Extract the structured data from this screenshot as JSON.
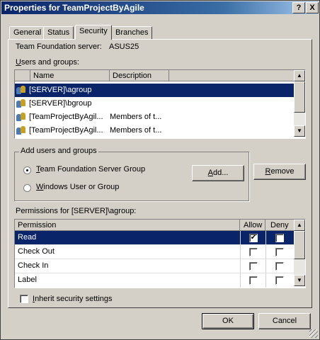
{
  "window": {
    "title": "Properties for TeamProjectByAgile",
    "help_btn": "?",
    "close_btn": "X"
  },
  "tabs": [
    {
      "label": "General"
    },
    {
      "label": "Status"
    },
    {
      "label": "Security"
    },
    {
      "label": "Branches"
    }
  ],
  "server": {
    "label": "Team Foundation server:",
    "value": "ASUS25"
  },
  "users": {
    "label": "Users and groups:",
    "columns": [
      "Name",
      "Description"
    ],
    "rows": [
      {
        "name": "[SERVER]\\agroup",
        "description": ""
      },
      {
        "name": "[SERVER]\\bgroup",
        "description": ""
      },
      {
        "name": "[TeamProjectByAgil...",
        "description": "Members of t..."
      },
      {
        "name": "[TeamProjectByAgil...",
        "description": "Members of t..."
      }
    ]
  },
  "add_group": {
    "legend": "Add users and groups",
    "option1": "Team Foundation Server Group",
    "option2": "Windows User or Group",
    "add_button": "Add...",
    "remove_button": "Remove"
  },
  "permissions": {
    "label": "Permissions for [SERVER]\\agroup:",
    "columns": [
      "Permission",
      "Allow",
      "Deny"
    ],
    "rows": [
      {
        "name": "Read",
        "allow": true,
        "deny": false
      },
      {
        "name": "Check Out",
        "allow": false,
        "deny": false
      },
      {
        "name": "Check In",
        "allow": false,
        "deny": false
      },
      {
        "name": "Label",
        "allow": false,
        "deny": false
      }
    ]
  },
  "inherit": {
    "label": "Inherit security settings"
  },
  "footer": {
    "ok": "OK",
    "cancel": "Cancel"
  },
  "icons": {
    "group": "user-group-icon",
    "check": "✔"
  }
}
